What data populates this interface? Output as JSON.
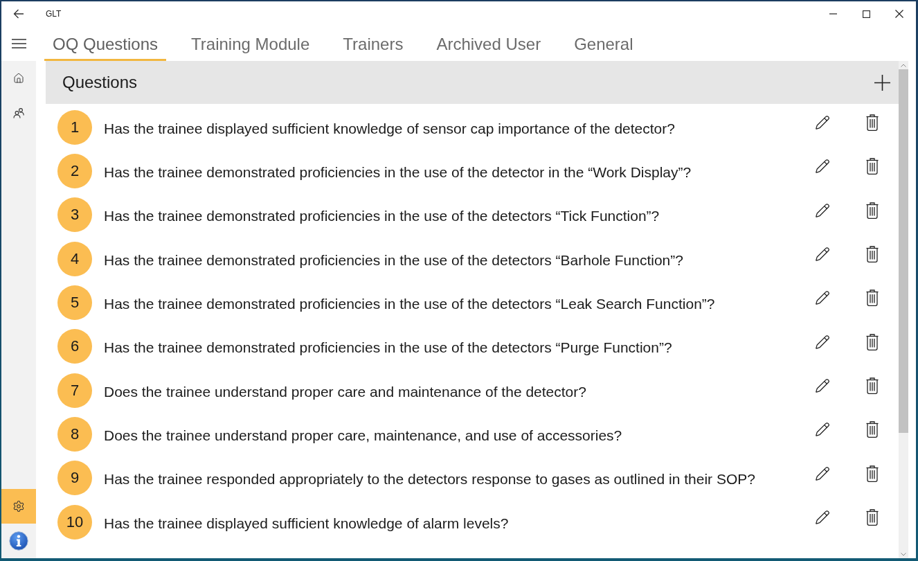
{
  "window": {
    "title": "GLT"
  },
  "tabs": [
    {
      "label": "OQ Questions",
      "selected": true
    },
    {
      "label": "Training Module",
      "selected": false
    },
    {
      "label": "Trainers",
      "selected": false
    },
    {
      "label": "Archived User",
      "selected": false
    },
    {
      "label": "General",
      "selected": false
    }
  ],
  "nav_rail": {
    "top_items": [
      {
        "selected": false
      },
      {
        "selected": false
      }
    ],
    "bottom_items": [
      {
        "selected": true
      },
      {
        "selected": false
      }
    ]
  },
  "panel": {
    "title": "Questions"
  },
  "questions": [
    {
      "number": "1",
      "text": "Has the trainee displayed sufficient knowledge of sensor cap importance of the detector?"
    },
    {
      "number": "2",
      "text": "Has the trainee demonstrated proficiencies in the use of the detector in the “Work Display”?"
    },
    {
      "number": "3",
      "text": "Has the trainee demonstrated proficiencies in the use of the detectors “Tick Function”?"
    },
    {
      "number": "4",
      "text": "Has the trainee demonstrated proficiencies in the use of the detectors “Barhole Function”?"
    },
    {
      "number": "5",
      "text": "Has the trainee demonstrated proficiencies in the use of the detectors “Leak Search Function”?"
    },
    {
      "number": "6",
      "text": "Has the trainee demonstrated proficiencies in the use of the detectors “Purge Function”?"
    },
    {
      "number": "7",
      "text": "Does the trainee understand proper care and maintenance of the detector?"
    },
    {
      "number": "8",
      "text": "Does the trainee understand proper care, maintenance, and use of accessories?"
    },
    {
      "number": "9",
      "text": "Has the trainee responded appropriately to the detectors response to gases as outlined in their SOP?"
    },
    {
      "number": "10",
      "text": "Has the trainee displayed sufficient knowledge of alarm levels?"
    }
  ]
}
